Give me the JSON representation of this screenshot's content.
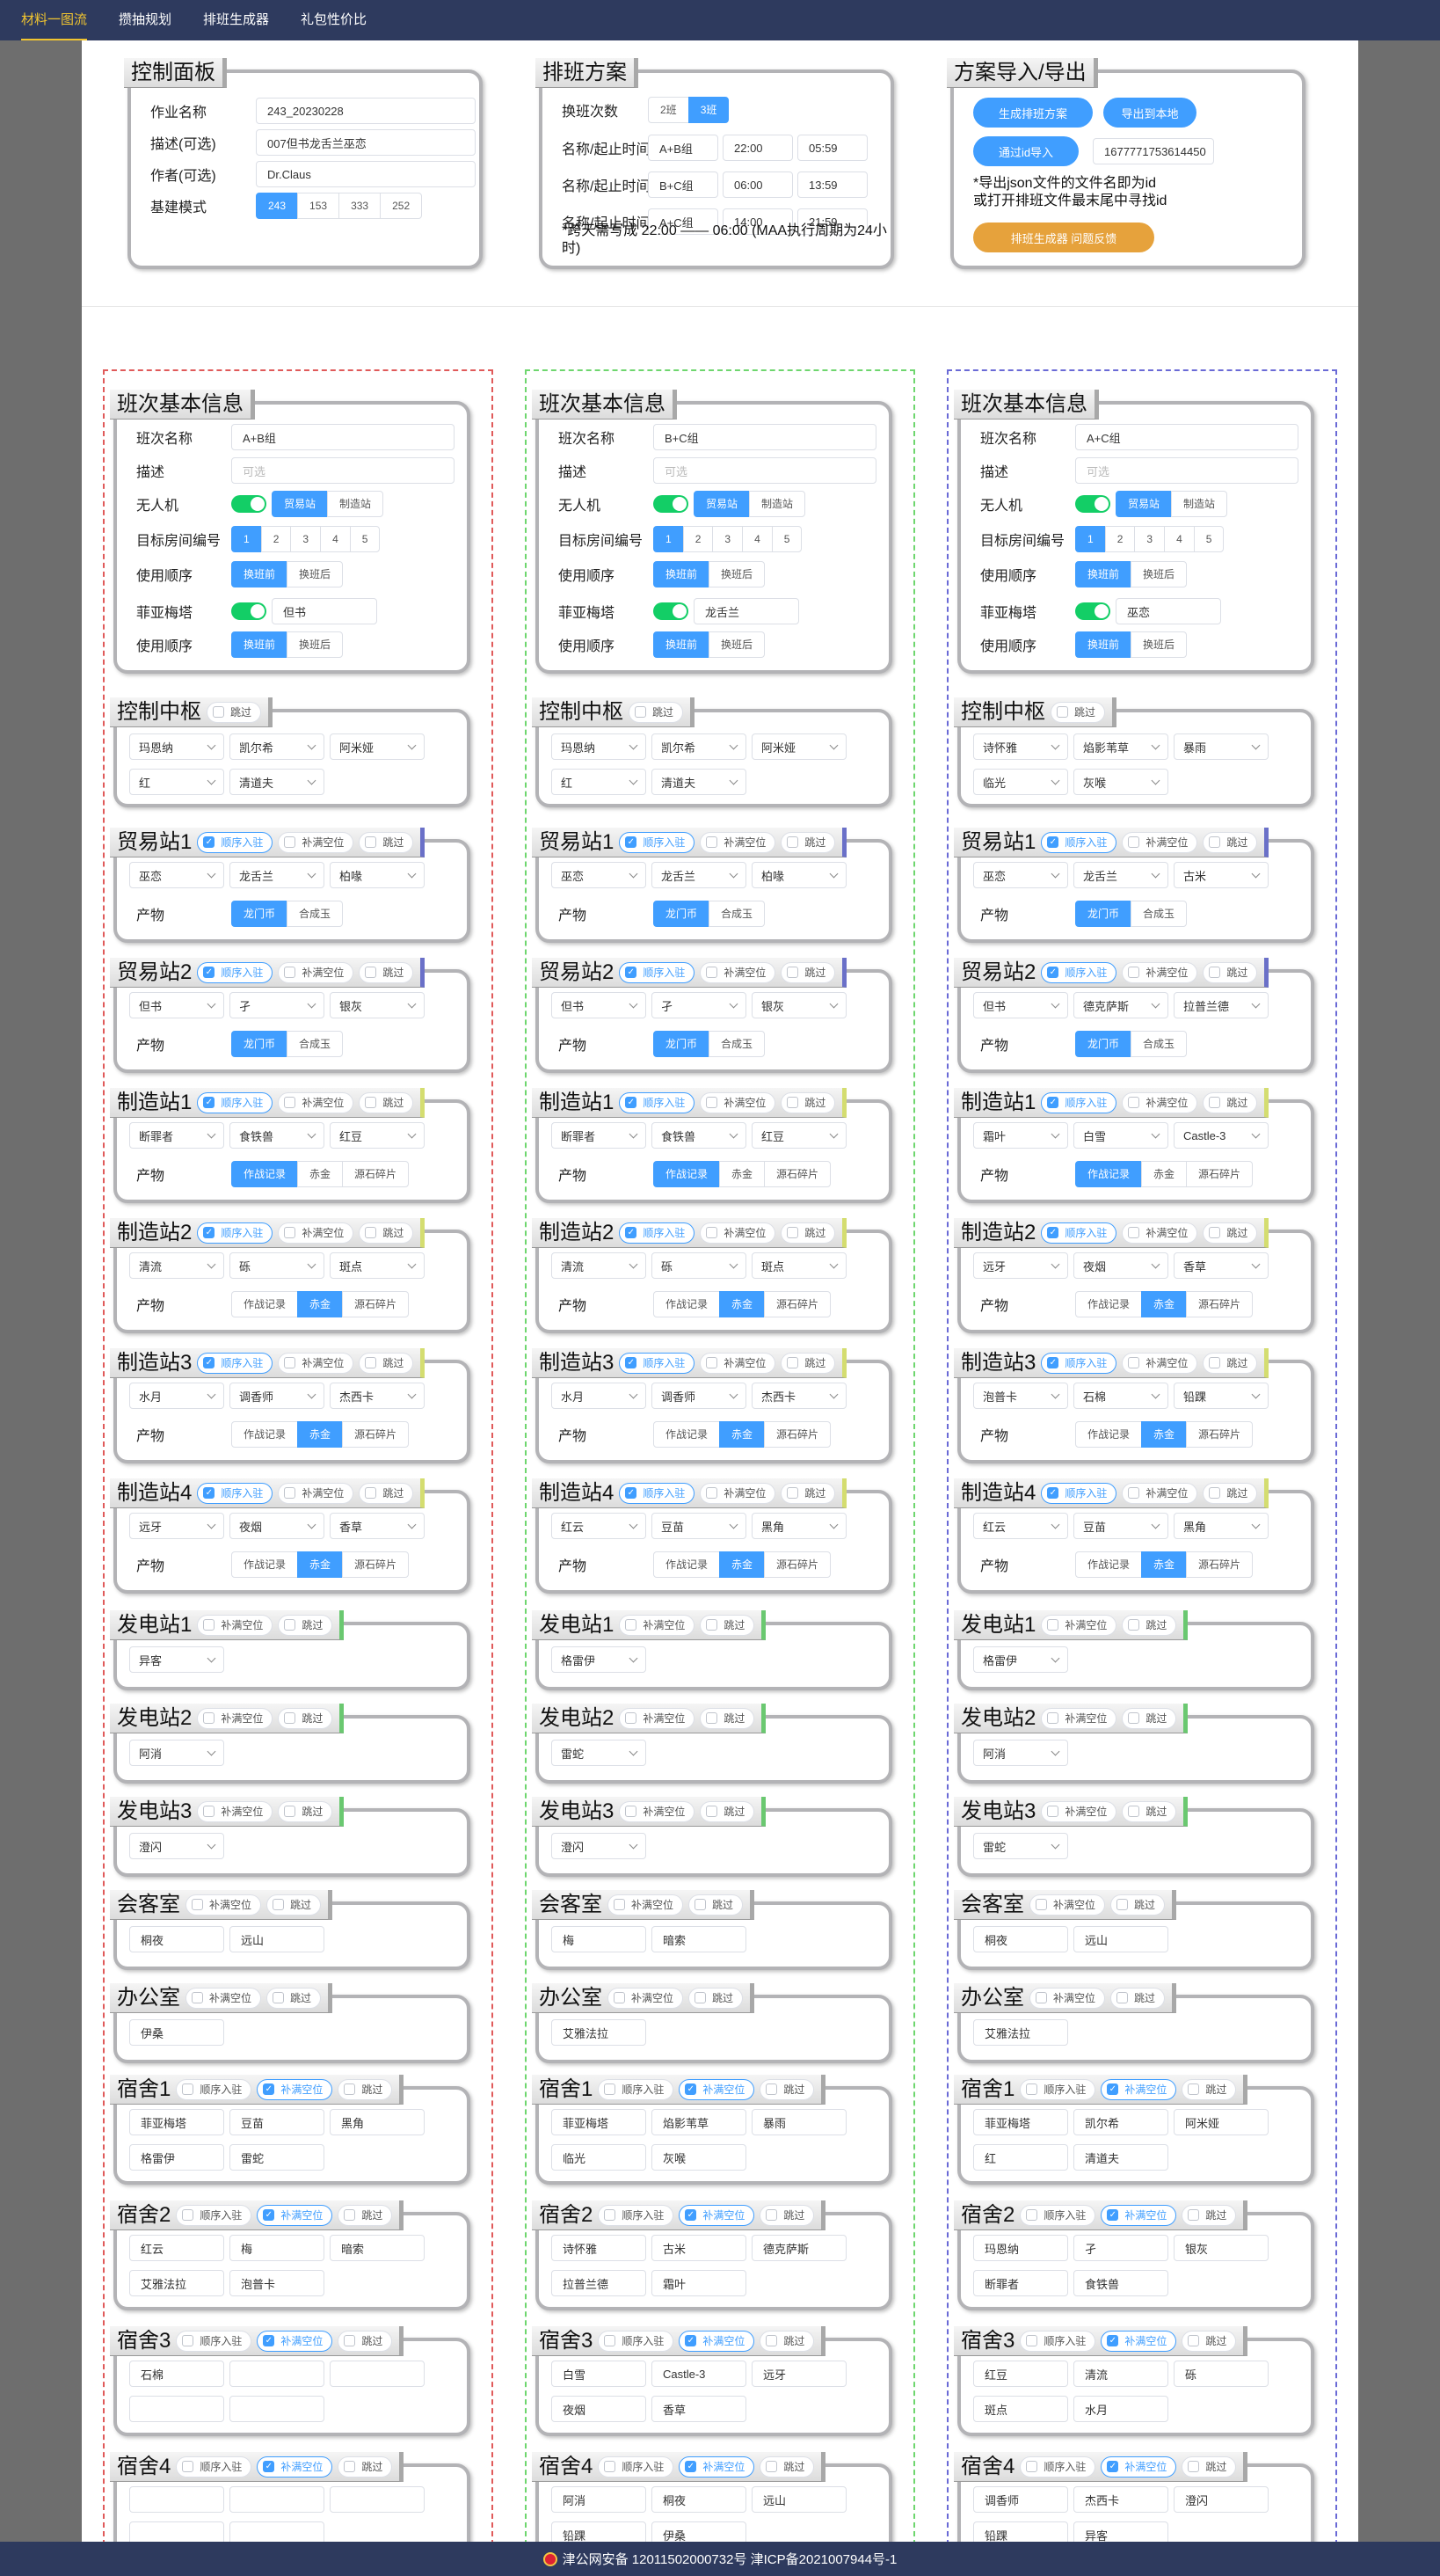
{
  "nav": [
    "材料一图流",
    "攒抽规划",
    "排班生成器",
    "礼包性价比"
  ],
  "control": {
    "title": "控制面板",
    "fields": [
      {
        "label": "作业名称",
        "value": "243_20230228"
      },
      {
        "label": "描述(可选)",
        "value": "007但书龙舌兰巫恋"
      },
      {
        "label": "作者(可选)",
        "value": "Dr.Claus"
      }
    ],
    "mode_label": "基建模式",
    "modes": [
      "243",
      "153",
      "333",
      "252"
    ],
    "mode_selected": "243"
  },
  "schedule": {
    "title": "排班方案",
    "count_label": "换班次数",
    "counts": [
      "2班",
      "3班"
    ],
    "count_selected": "3班",
    "shifts": [
      {
        "label": "名称/起止时间",
        "name": "A+B组",
        "start": "22:00",
        "end": "05:59"
      },
      {
        "label": "名称/起止时间",
        "name": "B+C组",
        "start": "06:00",
        "end": "13:59"
      },
      {
        "label": "名称/起止时间",
        "name": "A+C组",
        "start": "14:00",
        "end": "21:59"
      }
    ],
    "note": "*跨天需写成 22:00 —— 06:00 (MAA执行周期为24小时)"
  },
  "io": {
    "title": "方案导入/导出",
    "gen": "生成排班方案",
    "export": "导出到本地",
    "import": "通过id导入",
    "id_value": "1677771753614450",
    "note": "*导出json文件的文件名即为id\n或打开排班文件最末尾中寻找id",
    "feedback": "排班生成器 问题反馈"
  },
  "labels": {
    "basic": "班次基本信息",
    "name": "班次名称",
    "desc": "描述",
    "drone": "无人机",
    "room": "目标房间编号",
    "order": "使用顺序",
    "fiam": "菲亚梅塔",
    "product": "产物",
    "desc_ph": "可选",
    "seq": "顺序入驻",
    "fill": "补满空位",
    "skip": "跳过",
    "before": "换班前",
    "after": "换班后",
    "trade": "贸易站",
    "make": "制造站",
    "rooms": [
      "1",
      "2",
      "3",
      "4",
      "5"
    ]
  },
  "columns": [
    {
      "name": "A+B组",
      "color": "#e05a5a",
      "drone": "贸易站",
      "room": "1",
      "order": "换班前",
      "fiam_name": "但书",
      "fiam_order": "换班前",
      "control": [
        "玛恩纳",
        "凯尔希",
        "阿米娅",
        "红",
        "清道夫"
      ],
      "trade1": {
        "ops": [
          "巫恋",
          "龙舌兰",
          "柏喙"
        ],
        "product": "龙门币"
      },
      "trade2": {
        "ops": [
          "但书",
          "孑",
          "银灰"
        ],
        "product": "龙门币"
      },
      "make1": {
        "ops": [
          "断罪者",
          "食铁兽",
          "红豆"
        ],
        "product": "作战记录"
      },
      "make2": {
        "ops": [
          "清流",
          "砾",
          "斑点"
        ],
        "product": "赤金"
      },
      "make3": {
        "ops": [
          "水月",
          "调香师",
          "杰西卡"
        ],
        "product": "赤金"
      },
      "make4": {
        "ops": [
          "远牙",
          "夜烟",
          "香草"
        ],
        "product": "赤金"
      },
      "power": [
        "异客",
        "阿消",
        "澄闪"
      ],
      "meet": [
        "桐夜",
        "远山"
      ],
      "office": [
        "伊桑"
      ],
      "dorm": [
        [
          "菲亚梅塔",
          "豆苗",
          "黑角",
          "格雷伊",
          "雷蛇"
        ],
        [
          "红云",
          "梅",
          "暗索",
          "艾雅法拉",
          "泡普卡"
        ],
        [
          "石棉",
          "",
          "",
          "",
          ""
        ],
        [
          "",
          "",
          "",
          "",
          ""
        ]
      ]
    },
    {
      "name": "B+C组",
      "color": "#6ed66e",
      "drone": "贸易站",
      "room": "1",
      "order": "换班前",
      "fiam_name": "龙舌兰",
      "fiam_order": "换班前",
      "control": [
        "玛恩纳",
        "凯尔希",
        "阿米娅",
        "红",
        "清道夫"
      ],
      "trade1": {
        "ops": [
          "巫恋",
          "龙舌兰",
          "柏喙"
        ],
        "product": "龙门币"
      },
      "trade2": {
        "ops": [
          "但书",
          "孑",
          "银灰"
        ],
        "product": "龙门币"
      },
      "make1": {
        "ops": [
          "断罪者",
          "食铁兽",
          "红豆"
        ],
        "product": "作战记录"
      },
      "make2": {
        "ops": [
          "清流",
          "砾",
          "斑点"
        ],
        "product": "赤金"
      },
      "make3": {
        "ops": [
          "水月",
          "调香师",
          "杰西卡"
        ],
        "product": "赤金"
      },
      "make4": {
        "ops": [
          "红云",
          "豆苗",
          "黑角"
        ],
        "product": "赤金"
      },
      "power": [
        "格雷伊",
        "雷蛇",
        "澄闪"
      ],
      "meet": [
        "梅",
        "暗索"
      ],
      "office": [
        "艾雅法拉"
      ],
      "dorm": [
        [
          "菲亚梅塔",
          "焰影苇草",
          "暴雨",
          "临光",
          "灰喉"
        ],
        [
          "诗怀雅",
          "古米",
          "德克萨斯",
          "拉普兰德",
          "霜叶"
        ],
        [
          "白雪",
          "Castle-3",
          "远牙",
          "夜烟",
          "香草"
        ],
        [
          "阿消",
          "桐夜",
          "远山",
          "铅踝",
          "伊桑"
        ]
      ]
    },
    {
      "name": "A+C组",
      "color": "#6a6ad6",
      "drone": "贸易站",
      "room": "1",
      "order": "换班前",
      "fiam_name": "巫恋",
      "fiam_order": "换班前",
      "control": [
        "诗怀雅",
        "焰影苇草",
        "暴雨",
        "临光",
        "灰喉"
      ],
      "trade1": {
        "ops": [
          "巫恋",
          "龙舌兰",
          "古米"
        ],
        "product": "龙门币"
      },
      "trade2": {
        "ops": [
          "但书",
          "德克萨斯",
          "拉普兰德"
        ],
        "product": "龙门币"
      },
      "make1": {
        "ops": [
          "霜叶",
          "白雪",
          "Castle-3"
        ],
        "product": "作战记录"
      },
      "make2": {
        "ops": [
          "远牙",
          "夜烟",
          "香草"
        ],
        "product": "赤金"
      },
      "make3": {
        "ops": [
          "泡普卡",
          "石棉",
          "铅踝"
        ],
        "product": "赤金"
      },
      "make4": {
        "ops": [
          "红云",
          "豆苗",
          "黑角"
        ],
        "product": "赤金"
      },
      "power": [
        "格雷伊",
        "阿消",
        "雷蛇"
      ],
      "meet": [
        "桐夜",
        "远山"
      ],
      "office": [
        "艾雅法拉"
      ],
      "dorm": [
        [
          "菲亚梅塔",
          "凯尔希",
          "阿米娅",
          "红",
          "清道夫"
        ],
        [
          "玛恩纳",
          "孑",
          "银灰",
          "断罪者",
          "食铁兽"
        ],
        [
          "红豆",
          "清流",
          "砾",
          "斑点",
          "水月"
        ],
        [
          "调香师",
          "杰西卡",
          "澄闪",
          "铅踝",
          "异客"
        ]
      ]
    }
  ],
  "products": {
    "trade": [
      "龙门币",
      "合成玉"
    ],
    "make": [
      "作战记录",
      "赤金",
      "源石碎片"
    ]
  },
  "footer": "津公网安备 12011502000732号 津ICP备2021007944号-1"
}
